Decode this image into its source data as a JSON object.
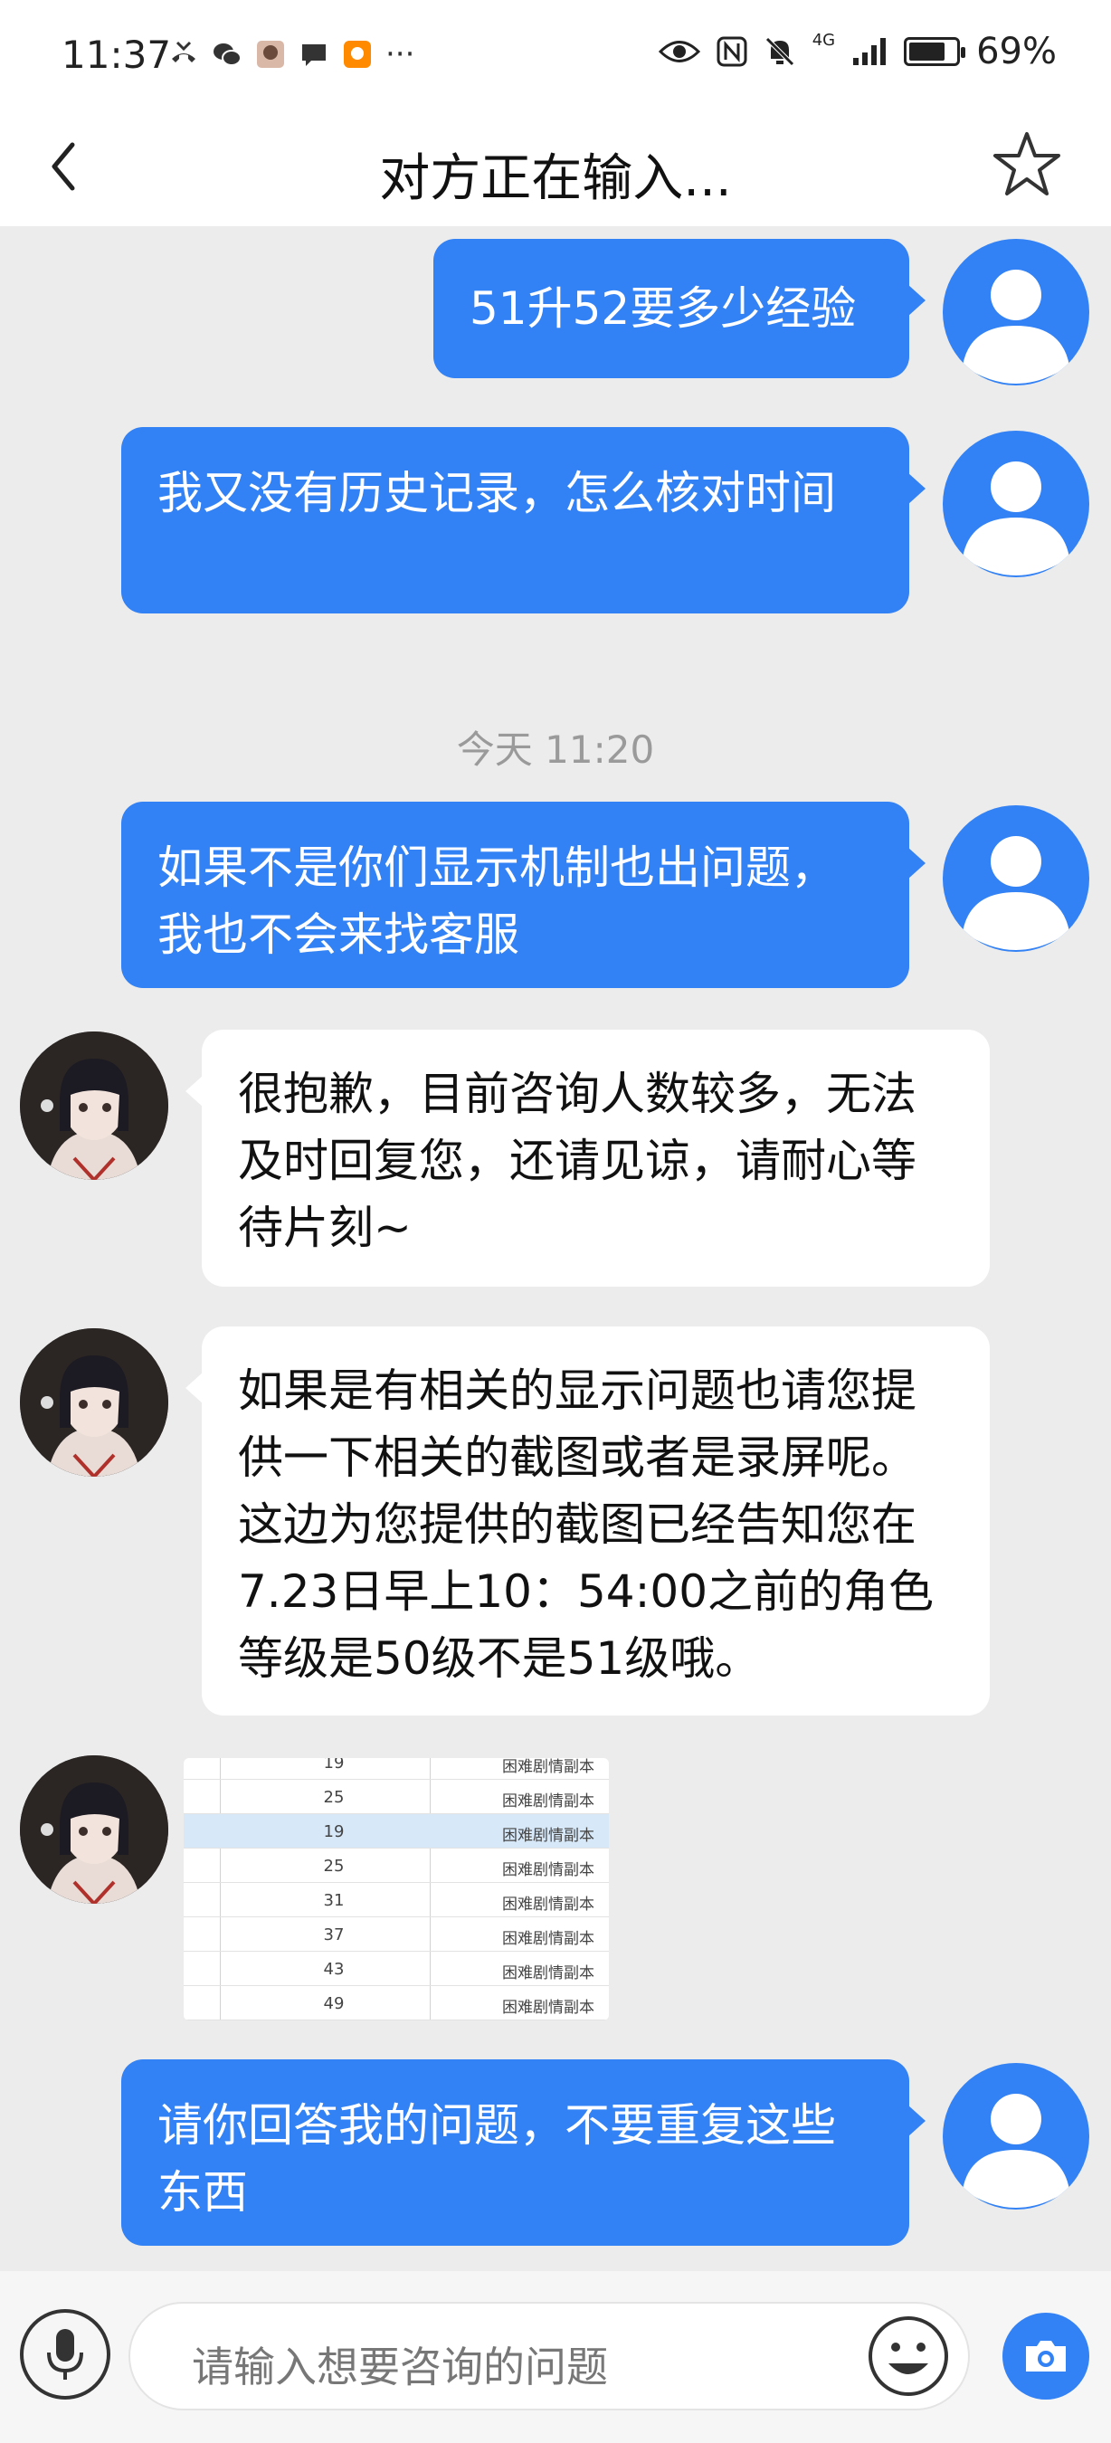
{
  "status_bar": {
    "time": "11:37",
    "more": "···",
    "network": "4G",
    "battery": "69%",
    "battery_level": 0.69
  },
  "header": {
    "title": "对方正在输入...",
    "back_icon": "chevron-left-icon",
    "favorite_icon": "star-outline-icon"
  },
  "messages": [
    {
      "from": "user",
      "text": "51升52要多少经验"
    },
    {
      "from": "user",
      "text": "我又没有历史记录，怎么核对时间"
    },
    {
      "type": "timestamp",
      "text": "今天 11:20"
    },
    {
      "from": "user",
      "text": "如果不是你们显示机制也出问题，我也不会来找客服"
    },
    {
      "from": "agent",
      "text": "很抱歉，目前咨询人数较多，无法及时回复您，还请见谅，请耐心等待片刻~"
    },
    {
      "from": "agent",
      "text": "如果是有相关的显示问题也请您提供一下相关的截图或者是录屏呢。这边为您提供的截图已经告知您在7.23日早上10：54:00之前的角色等级是50级不是51级哦。"
    },
    {
      "from": "agent",
      "type": "image",
      "table_rows": [
        {
          "level": "19",
          "source": "困难剧情副本"
        },
        {
          "level": "25",
          "source": "困难剧情副本"
        },
        {
          "level": "19",
          "source": "困难剧情副本",
          "highlight": true
        },
        {
          "level": "25",
          "source": "困难剧情副本"
        },
        {
          "level": "31",
          "source": "困难剧情副本"
        },
        {
          "level": "37",
          "source": "困难剧情副本"
        },
        {
          "level": "43",
          "source": "困难剧情副本"
        },
        {
          "level": "49",
          "source": "困难剧情副本"
        }
      ]
    },
    {
      "from": "user",
      "text": "请你回答我的问题，不要重复这些东西"
    }
  ],
  "input_bar": {
    "placeholder": "请输入想要咨询的问题",
    "mic_icon": "microphone-icon",
    "emoji_icon": "emoji-icon",
    "camera_icon": "camera-icon"
  },
  "colors": {
    "accent": "#3281f5",
    "chat_background": "#ececec",
    "bubble_in": "#ffffff"
  }
}
